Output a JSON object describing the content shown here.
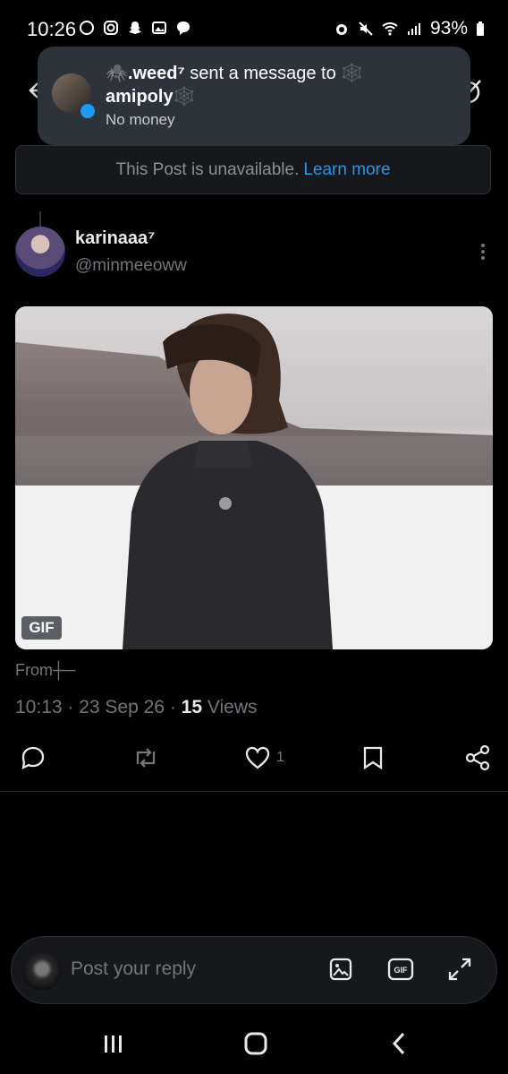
{
  "status_bar": {
    "time": "10:26",
    "battery": "93%",
    "left_icons": [
      "chat-bubble-icon",
      "instagram-icon",
      "snapchat-icon",
      "gallery-icon",
      "message-icon"
    ],
    "right_icons": [
      "alarm-icon",
      "mute-icon",
      "wifi-icon",
      "signal-icon",
      "battery-icon"
    ]
  },
  "notification": {
    "sender": ".weed⁷",
    "action_text": "sent a message to",
    "recipient": "amipoly",
    "message": "No money",
    "sender_emoji": "🕷️",
    "target_emoji": "🕸️",
    "dot_color": "#1d9bf0"
  },
  "unavailable": {
    "text": "This Post is unavailable.",
    "link": "Learn more"
  },
  "post": {
    "display_name": "karinaaa⁷",
    "handle": "@minmeeoww",
    "media_badge": "GIF",
    "from_label": "From",
    "from_glyph": "┼─",
    "time": "10:13",
    "date": "23 Sep 26",
    "views_count": "15",
    "views_label": "Views",
    "like_count": "1"
  },
  "reply": {
    "placeholder": "Post your reply"
  },
  "colors": {
    "accent": "#1d9bf0",
    "background": "#000000",
    "muted": "#71767b"
  }
}
